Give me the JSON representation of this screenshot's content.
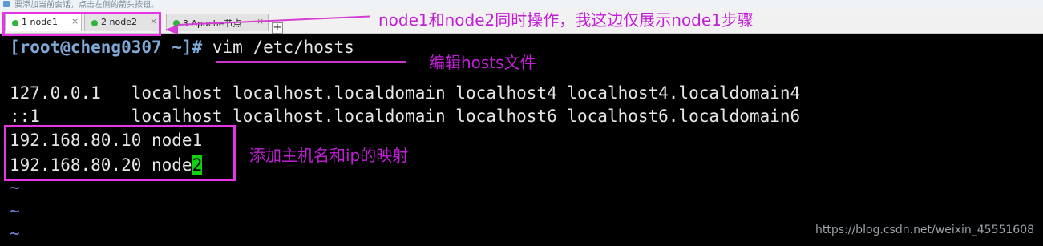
{
  "hint": {
    "text": "要添加当前会话，点击左侧的箭头按钮。"
  },
  "tabs": [
    {
      "number": "1",
      "name": "node1",
      "close": "×"
    },
    {
      "number": "2",
      "name": "node2",
      "close": "×"
    },
    {
      "number": "3",
      "name": "Apache节点",
      "close": "×"
    }
  ],
  "new_tab": "+",
  "terminal": {
    "prompt": "[root@cheng0307 ~]#",
    "command": " vim /etc/hosts",
    "lines": [
      "127.0.0.1   localhost localhost.localdomain localhost4 localhost4.localdomain4",
      "::1         localhost localhost.localdomain localhost6 localhost6.localdomain6",
      "192.168.80.10 node1",
      "192.168.80.20 node",
      "2"
    ],
    "tilde": "~"
  },
  "annotations": {
    "tab_note": "node1和node2同时操作，我这边仅展示node1步骤",
    "vim_note": "编辑hosts文件",
    "ip_note": "添加主机名和ip的映射"
  },
  "watermark": "https://blog.csdn.net/weixin_45551608",
  "colors": {
    "annotation": "#c21ed7",
    "terminal_bg": "#000000",
    "cursor": "#10d010"
  }
}
